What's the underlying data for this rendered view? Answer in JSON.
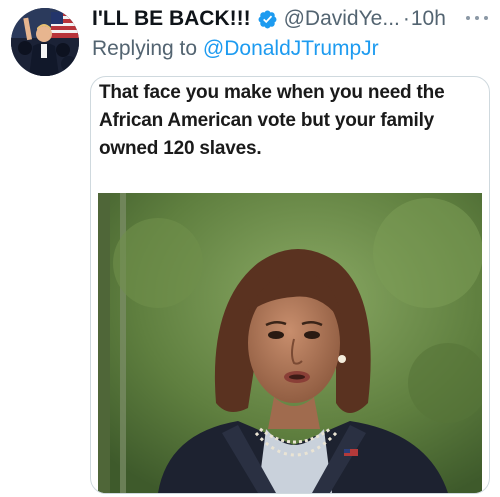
{
  "tweet": {
    "display_name": "I'LL BE BACK!!!",
    "handle": "@DavidYe...",
    "separator": "·",
    "time": "10h",
    "verified_icon": "verified-badge-icon",
    "more_icon": "more-options-icon",
    "reply_prefix": "Replying to ",
    "reply_to": "@DonaldJTrumpJr"
  },
  "media": {
    "caption": "That face you make when you need the African American vote but your family owned 120 slaves."
  },
  "colors": {
    "link": "#1d9bf0",
    "secondary_text": "#536471",
    "primary_text": "#0f1419",
    "verified": "#1d9bf0"
  }
}
